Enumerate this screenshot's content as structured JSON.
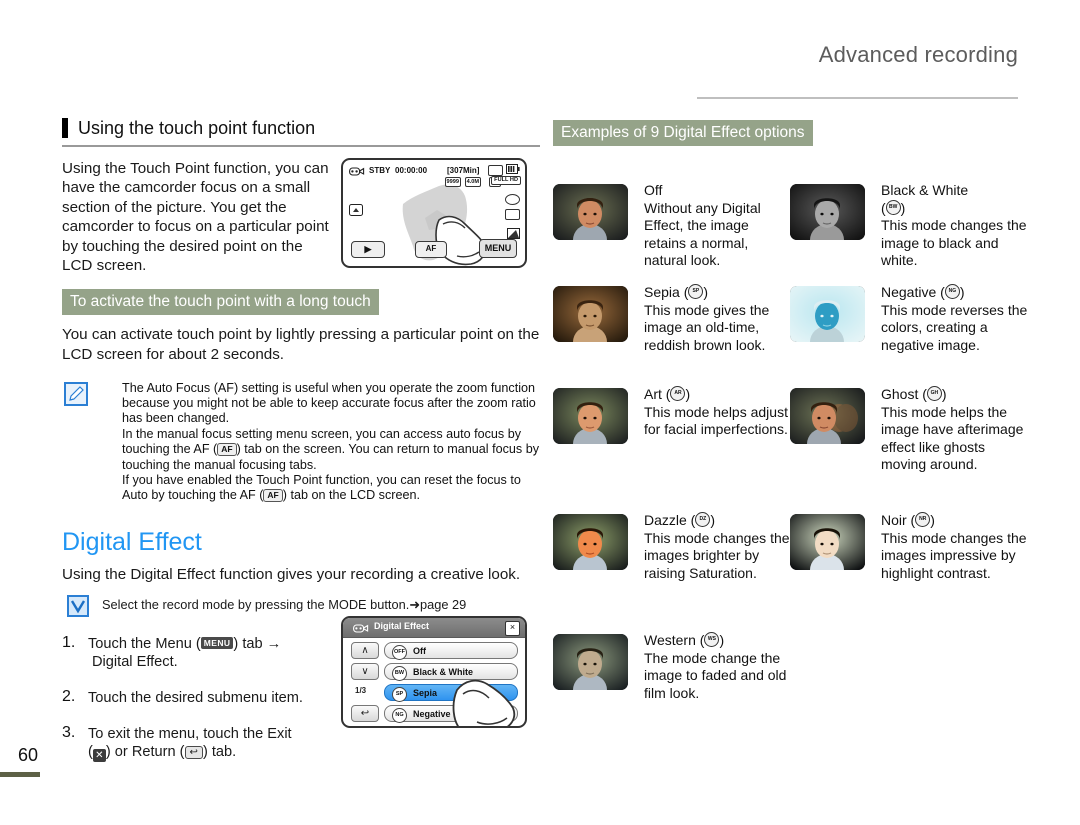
{
  "header": {
    "title": "Advanced recording"
  },
  "left": {
    "section_heading": "Using the touch point function",
    "intro": "Using the Touch Point function, you can have the camcorder focus on a small section of the picture. You get the camcorder to focus on a particular point by touching the desired point on the LCD screen.",
    "subhead_greenbar": "To activate the touch point with a long touch",
    "paragraph": "You can activate touch point by lightly pressing a particular point on the LCD screen for about 2 seconds.",
    "note_icon": "pencil-note-icon",
    "note_lines": [
      "The Auto Focus (AF) setting is useful when you operate the zoom function because you might not be able to keep accurate focus after the zoom ratio has been changed.",
      "In the manual focus setting menu screen, you can access auto focus by touching the AF (  ) tab on the screen. You can return to manual focus by touching the manual focusing tabs.",
      "If you have enabled the Touch Point function, you can reset the focus to Auto by touching the AF (  ) tab on the LCD screen."
    ],
    "note_line2_pre": "In the manual focus setting menu screen, you can access auto focus by touching the AF (",
    "note_line2_post": ") tab on the screen. You can return to manual focus by touching the manual focusing tabs.",
    "note_line3_pre": "If you have enabled the Touch Point function, you can reset the focus to Auto by touching the AF (",
    "note_line3_post": ") tab on the LCD screen.",
    "big_heading": "Digital Effect",
    "big_heading_color": "#2196f3",
    "big_paragraph": "Using the Digital Effect function gives your recording a creative look.",
    "check_icon": "checkmark-box-icon",
    "check_note_pre": "Select the record mode by pressing the MODE button.",
    "check_note_arrow": "➜",
    "check_note_post": "page 29",
    "steps": [
      {
        "num": "1.",
        "pre": "Touch the Menu (",
        "key": "MENU",
        "post": ") tab →",
        "second_line": "Digital Effect."
      },
      {
        "num": "2.",
        "pre": "Touch the desired submenu item.",
        "key": "",
        "post": "",
        "second_line": ""
      },
      {
        "num": "3.",
        "pre": "To exit the menu, touch the Exit",
        "key": "",
        "post": "",
        "second_line": ") or Return (      ) tab."
      }
    ],
    "step3_line2_pre": "(",
    "step3_line2_mid": ") or Return (",
    "step3_line2_post": ") tab."
  },
  "lcd_top": {
    "name": "touch-point-lcd-preview",
    "mode_icon": "camcorder-icon",
    "status": "STBY",
    "timecode": "00:00:00",
    "remaining": "[307Min]",
    "badges": [
      "9999",
      "4.0M",
      "SD",
      "FULL HD"
    ],
    "battery_icon": "battery-icon",
    "card_icon": "memory-card-icon",
    "play_btn": "▶",
    "af_tab": "AF",
    "menu_tab": "MENU"
  },
  "lcd_menu": {
    "name": "digital-effect-menu-screen",
    "title": "Digital Effect",
    "close_label": "×",
    "up_label": "∧",
    "down_label": "∨",
    "back_label": "↩",
    "page_indicator": "1/3",
    "items": [
      {
        "label": "Off",
        "icon_text": "OFF",
        "selected": false
      },
      {
        "label": "Black & White",
        "icon_text": "BW",
        "selected": false
      },
      {
        "label": "Sepia",
        "icon_text": "SP",
        "selected": true
      },
      {
        "label": "Negative",
        "icon_text": "NG",
        "selected": false
      }
    ]
  },
  "right": {
    "heading": "Examples of 9 Digital Effect options",
    "effects": [
      {
        "name": "Off",
        "icon": "",
        "desc": "Without any Digital Effect, the image retains a normal, natural look.",
        "thumb": "normal"
      },
      {
        "name": "Black & White",
        "icon": "BW",
        "icon_on_new_line": true,
        "desc": "This mode changes the image to black and white.",
        "thumb": "bw"
      },
      {
        "name": "Sepia",
        "icon": "SP",
        "desc": "This mode gives the image an old-time, reddish brown look.",
        "thumb": "sepia"
      },
      {
        "name": "Negative",
        "icon": "NG",
        "desc": "This mode reverses the colors, creating a negative image.",
        "thumb": "negative"
      },
      {
        "name": "Art",
        "icon": "AR",
        "desc": "This mode helps adjust for facial imperfections.",
        "thumb": "art"
      },
      {
        "name": "Ghost",
        "icon": "GH",
        "desc": "This mode helps the image have afterimage effect like ghosts moving around.",
        "thumb": "ghost"
      },
      {
        "name": "Dazzle",
        "icon": "DZ",
        "desc": "This mode changes the images brighter by raising Saturation.",
        "thumb": "dazzle"
      },
      {
        "name": "Noir",
        "icon": "NR",
        "desc": "This mode changes the images impressive by highlight contrast.",
        "thumb": "noir"
      },
      {
        "name": "Western",
        "icon": "WS",
        "desc": "The mode change the image to faded and old film look.",
        "thumb": "western"
      }
    ]
  },
  "footer": {
    "page_number": "60",
    "bar_color": "#5d6146"
  }
}
